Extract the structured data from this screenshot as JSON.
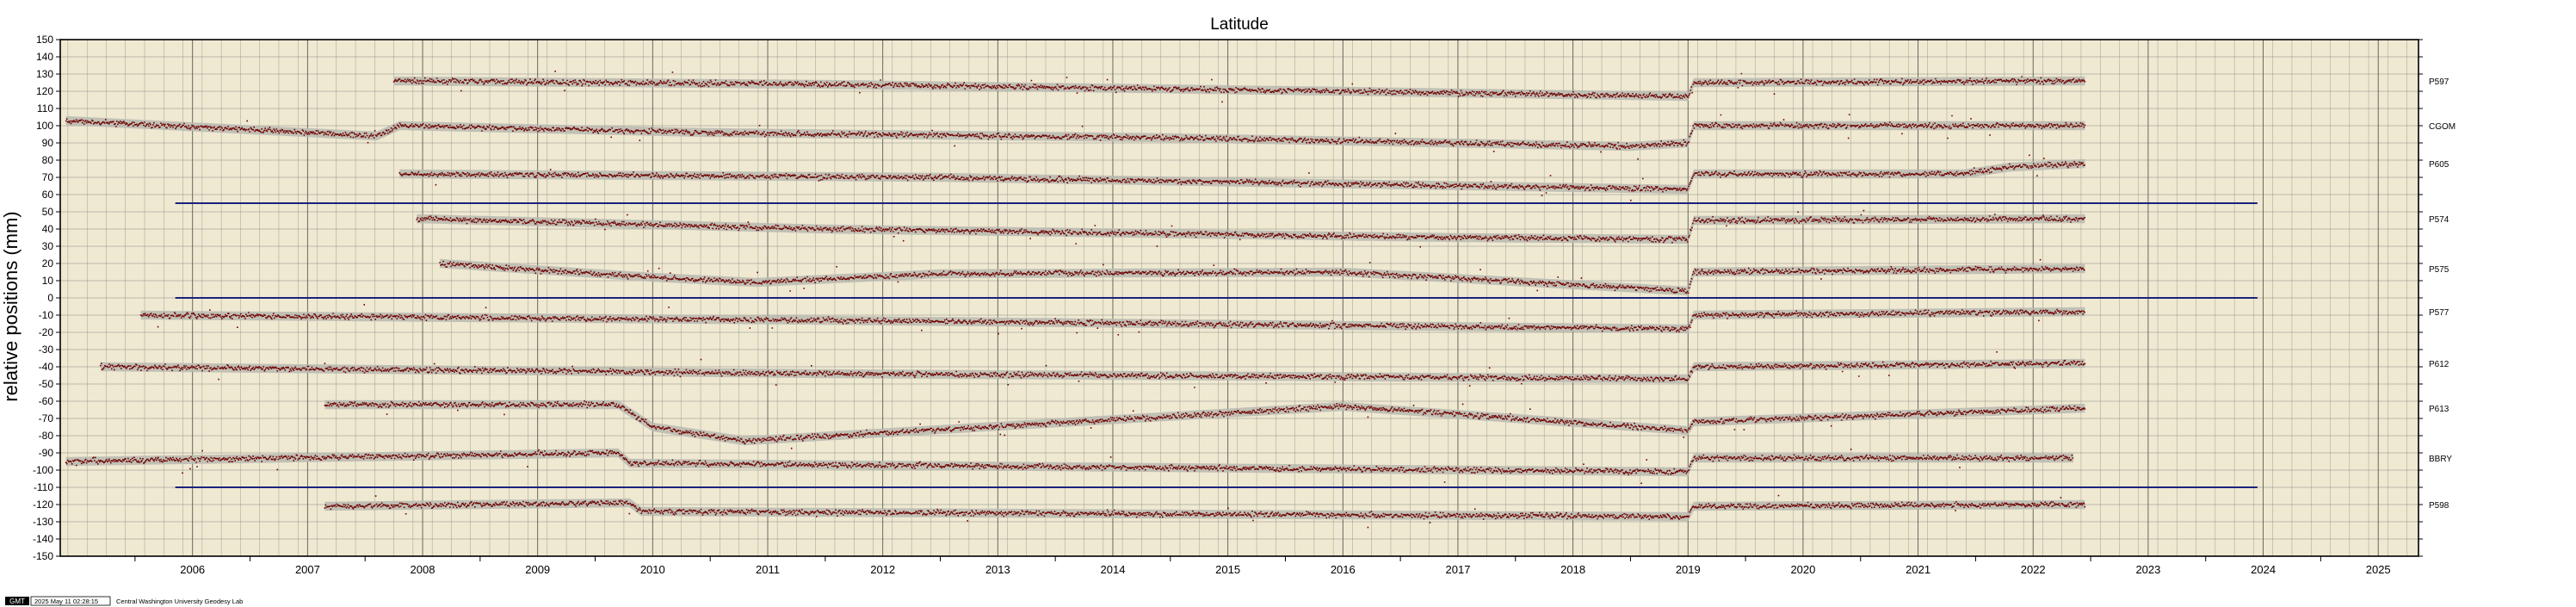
{
  "chart_data": {
    "type": "scatter",
    "title": "Latitude",
    "ylabel": "relative positions (mm)",
    "xlabel": "",
    "xlim": [
      2005.35,
      2025.85
    ],
    "ylim": [
      -150,
      150
    ],
    "grid": true,
    "ytick_step": 10,
    "x_ticks": [
      "2006",
      "2007",
      "2008",
      "2009",
      "2010",
      "2011",
      "2012",
      "2013",
      "2014",
      "2015",
      "2016",
      "2017",
      "2018",
      "2019",
      "2020",
      "2021",
      "2022",
      "2023",
      "2024",
      "2025"
    ],
    "reference_lines": [
      {
        "y": 55,
        "x_range": [
          2006.35,
          2024.45
        ]
      },
      {
        "y": 0,
        "x_range": [
          2006.35,
          2024.45
        ]
      },
      {
        "y": -110,
        "x_range": [
          2006.35,
          2024.45
        ]
      }
    ],
    "colors": {
      "background": "#efe9d2",
      "grid": "#8a8a80",
      "points": "#6e0000",
      "band": "#b8b8b0",
      "reference_line": "#1a237e"
    },
    "series": [
      {
        "name": "P597",
        "x_range": [
          2008.25,
          2022.95
        ],
        "levels": [
          [
            2008.25,
            126
          ],
          [
            2012,
            124
          ],
          [
            2016.5,
            120
          ],
          [
            2019.5,
            117
          ],
          [
            2019.55,
            125
          ],
          [
            2022.95,
            126
          ]
        ]
      },
      {
        "name": "CGOM",
        "x_range": [
          2005.4,
          2022.95
        ],
        "levels": [
          [
            2005.4,
            103
          ],
          [
            2008.1,
            94
          ],
          [
            2008.3,
            100
          ],
          [
            2011,
            96
          ],
          [
            2015,
            93
          ],
          [
            2019,
            88
          ],
          [
            2019.5,
            90
          ],
          [
            2019.55,
            100
          ],
          [
            2022.95,
            100
          ]
        ]
      },
      {
        "name": "P605",
        "x_range": [
          2008.3,
          2022.95
        ],
        "levels": [
          [
            2008.3,
            72
          ],
          [
            2013,
            70
          ],
          [
            2019.5,
            63
          ],
          [
            2019.55,
            72
          ],
          [
            2021.9,
            72
          ],
          [
            2022.3,
            76
          ],
          [
            2022.95,
            78
          ]
        ]
      },
      {
        "name": "P574",
        "x_range": [
          2008.45,
          2022.95
        ],
        "levels": [
          [
            2008.45,
            46
          ],
          [
            2012,
            40
          ],
          [
            2017.5,
            35
          ],
          [
            2019.5,
            34
          ],
          [
            2019.55,
            45
          ],
          [
            2022.95,
            46
          ]
        ]
      },
      {
        "name": "P575",
        "x_range": [
          2008.65,
          2022.95
        ],
        "levels": [
          [
            2008.65,
            20
          ],
          [
            2010.5,
            12
          ],
          [
            2011.4,
            9
          ],
          [
            2013,
            14
          ],
          [
            2016.5,
            15
          ],
          [
            2019.5,
            4
          ],
          [
            2019.55,
            15
          ],
          [
            2022.95,
            17
          ]
        ]
      },
      {
        "name": "P577",
        "x_range": [
          2006.05,
          2022.95
        ],
        "levels": [
          [
            2006.05,
            -10
          ],
          [
            2012,
            -13
          ],
          [
            2019.5,
            -18
          ],
          [
            2019.55,
            -10
          ],
          [
            2022.95,
            -8
          ]
        ]
      },
      {
        "name": "P612",
        "x_range": [
          2005.7,
          2022.95
        ],
        "levels": [
          [
            2005.7,
            -40
          ],
          [
            2012,
            -44
          ],
          [
            2019.5,
            -47
          ],
          [
            2019.55,
            -40
          ],
          [
            2022.95,
            -38
          ]
        ]
      },
      {
        "name": "P613",
        "x_range": [
          2007.65,
          2022.95
        ],
        "levels": [
          [
            2007.65,
            -62
          ],
          [
            2010.2,
            -62
          ],
          [
            2010.5,
            -75
          ],
          [
            2011.3,
            -83
          ],
          [
            2016.5,
            -63
          ],
          [
            2019.5,
            -77
          ],
          [
            2019.55,
            -72
          ],
          [
            2022.95,
            -64
          ]
        ]
      },
      {
        "name": "BBRY",
        "x_range": [
          2005.4,
          2022.85
        ],
        "levels": [
          [
            2005.4,
            -95
          ],
          [
            2010.2,
            -90
          ],
          [
            2010.3,
            -96
          ],
          [
            2019.5,
            -101
          ],
          [
            2019.55,
            -93
          ],
          [
            2022.85,
            -93
          ]
        ]
      },
      {
        "name": "P598",
        "x_range": [
          2007.65,
          2022.95
        ],
        "levels": [
          [
            2007.65,
            -121
          ],
          [
            2010.3,
            -119
          ],
          [
            2010.4,
            -124
          ],
          [
            2019.5,
            -127
          ],
          [
            2019.55,
            -121
          ],
          [
            2022.95,
            -120
          ]
        ]
      }
    ]
  },
  "footer": {
    "badge": "GMT",
    "timestamp": "2025 May 11 02:28:15",
    "credit": "Central Washington University Geodesy Lab"
  }
}
